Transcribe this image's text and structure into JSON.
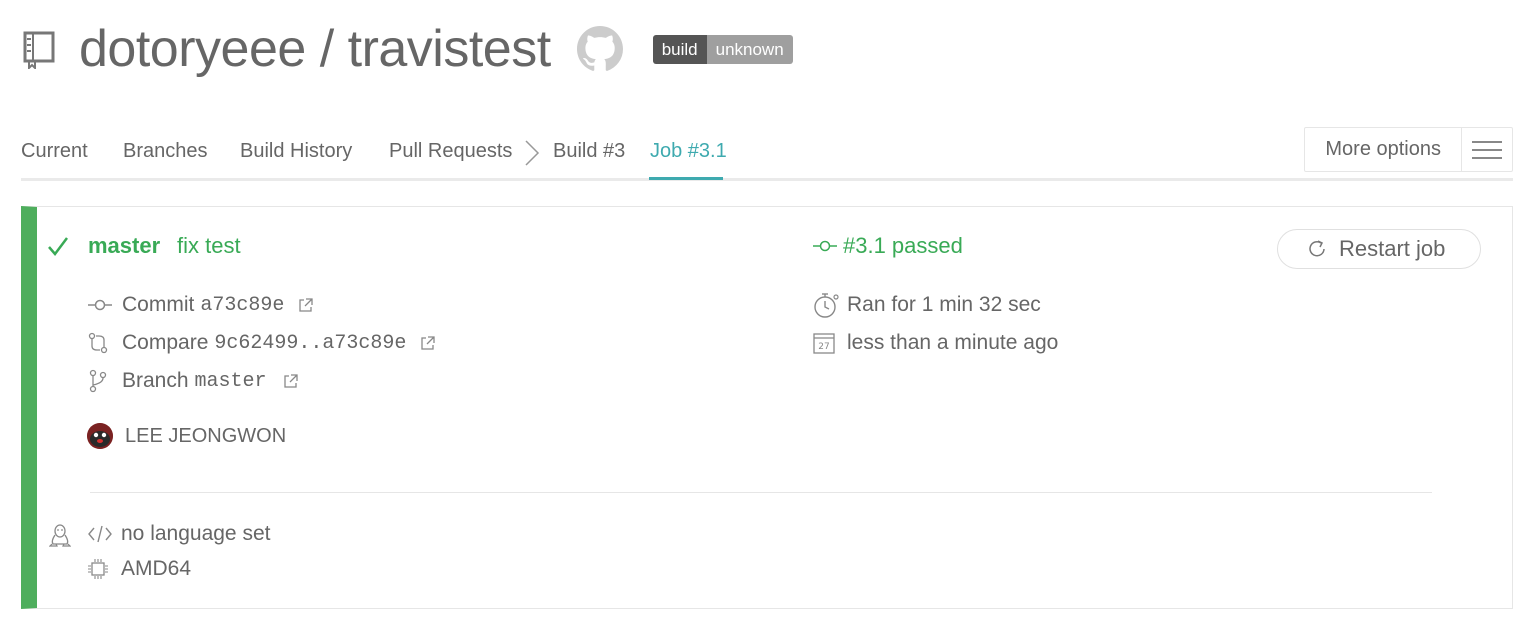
{
  "header": {
    "repo_title": "dotoryeee / travistest",
    "badge_left": "build",
    "badge_right": "unknown",
    "icons": [
      "repo-icon",
      "github-icon"
    ]
  },
  "tabs": {
    "items": [
      {
        "label": "Current"
      },
      {
        "label": "Branches"
      },
      {
        "label": "Build History"
      },
      {
        "label": "Pull Requests"
      },
      {
        "label": "Build #3"
      },
      {
        "label": "Job #3.1"
      }
    ],
    "active": "Job #3.1",
    "more_options": "More options"
  },
  "job": {
    "status": "passed",
    "branch": "master",
    "message": "fix test",
    "state_text": "#3.1 passed",
    "restart_label": "Restart job",
    "commit_label": "Commit",
    "commit_sha": "a73c89e",
    "compare_label": "Compare",
    "compare_range": "9c62499..a73c89e",
    "branch_label": "Branch",
    "branch_value": "master",
    "duration": "Ran for 1 min 32 sec",
    "finished": "less than a minute ago",
    "calendar_day": "27",
    "author": "LEE JEONGWON",
    "language": "no language set",
    "arch": "AMD64"
  },
  "colors": {
    "passed": "#39aa56",
    "accent": "#3eaaaf",
    "status_bar": "#4eae5d",
    "text": "#666666"
  }
}
